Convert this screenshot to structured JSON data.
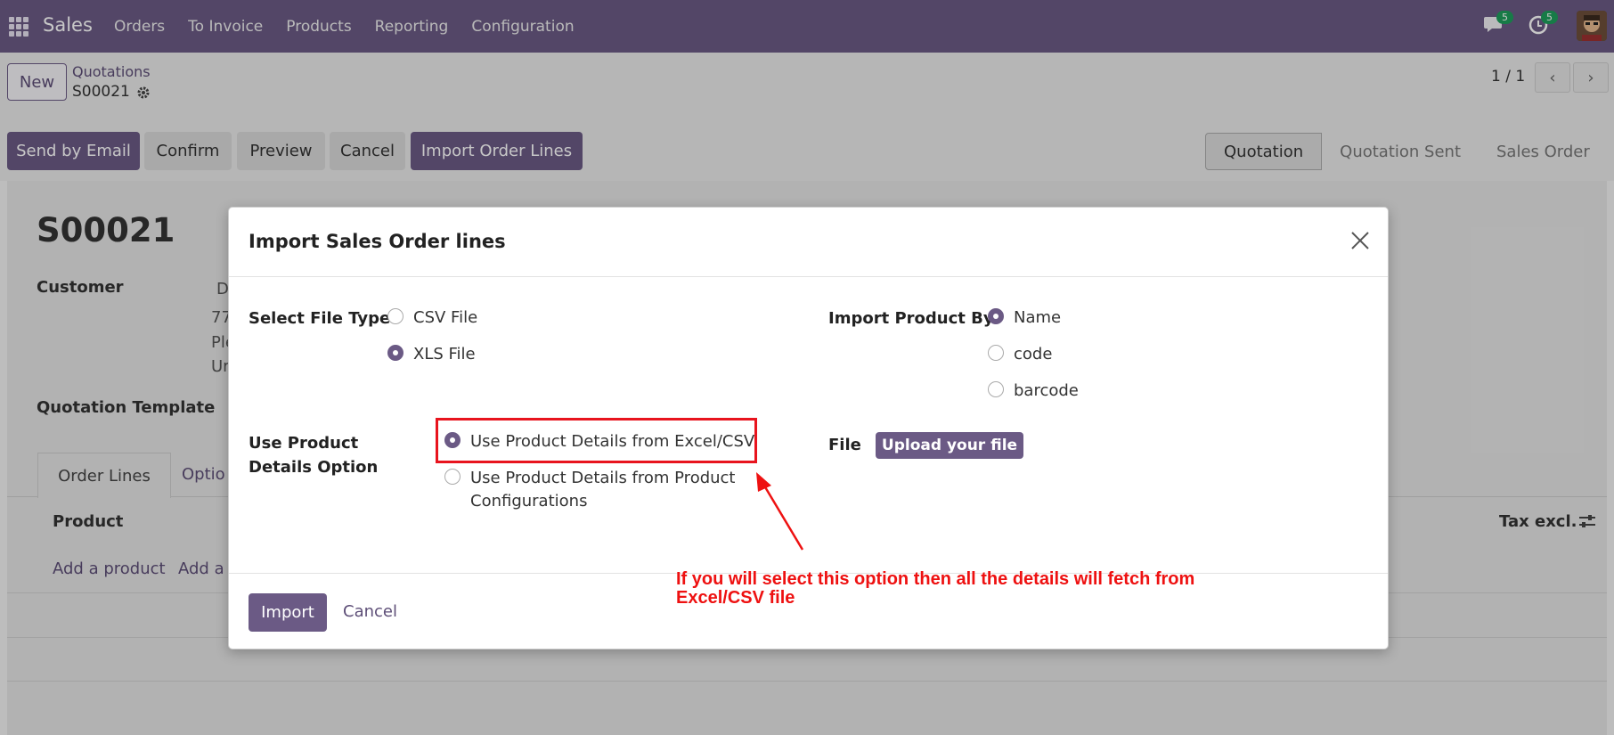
{
  "navbar": {
    "brand": "Sales",
    "menu": [
      "Orders",
      "To Invoice",
      "Products",
      "Reporting",
      "Configuration"
    ],
    "messages_count": "5",
    "activities_count": "5"
  },
  "control_panel": {
    "new_label": "New",
    "breadcrumb_parent": "Quotations",
    "breadcrumb_current": "S00021",
    "pager": "1 / 1"
  },
  "actions": {
    "send_by_email": "Send by Email",
    "confirm": "Confirm",
    "preview": "Preview",
    "cancel": "Cancel",
    "import_order_lines": "Import Order Lines"
  },
  "status_bar": [
    "Quotation",
    "Quotation Sent",
    "Sales Order"
  ],
  "form": {
    "record_name": "S00021",
    "customer_label": "Customer",
    "customer_partial": [
      "D",
      "77",
      "Ple",
      "Ur"
    ],
    "quotation_template_label": "Quotation Template",
    "tabs": [
      "Order Lines",
      "Optio"
    ],
    "col_product": "Product",
    "col_tax": "Tax excl.",
    "add_product": "Add a product",
    "add_section": "Add a s"
  },
  "modal": {
    "title": "Import Sales Order lines",
    "file_type_label": "Select File Type",
    "file_type_options": [
      {
        "label": "CSV File",
        "checked": false
      },
      {
        "label": "XLS File",
        "checked": true
      }
    ],
    "import_by_label": "Import Product By",
    "import_by_options": [
      {
        "label": "Name",
        "checked": true
      },
      {
        "label": "code",
        "checked": false
      },
      {
        "label": "barcode",
        "checked": false
      }
    ],
    "details_label": "Use Product Details Option",
    "details_options": [
      {
        "label": "Use Product Details from Excel/CSV",
        "checked": true
      },
      {
        "label": "Use Product Details from Product Configurations",
        "checked": false
      }
    ],
    "file_label": "File",
    "upload_label": "Upload your file",
    "import_button": "Import",
    "cancel_button": "Cancel"
  },
  "annotation": {
    "text": "If you will select this option then all the details will fetch from Excel/CSV file",
    "color": "#ee1111"
  },
  "colors": {
    "brand": "#6b5a85",
    "badge": "#1e9e5c"
  }
}
